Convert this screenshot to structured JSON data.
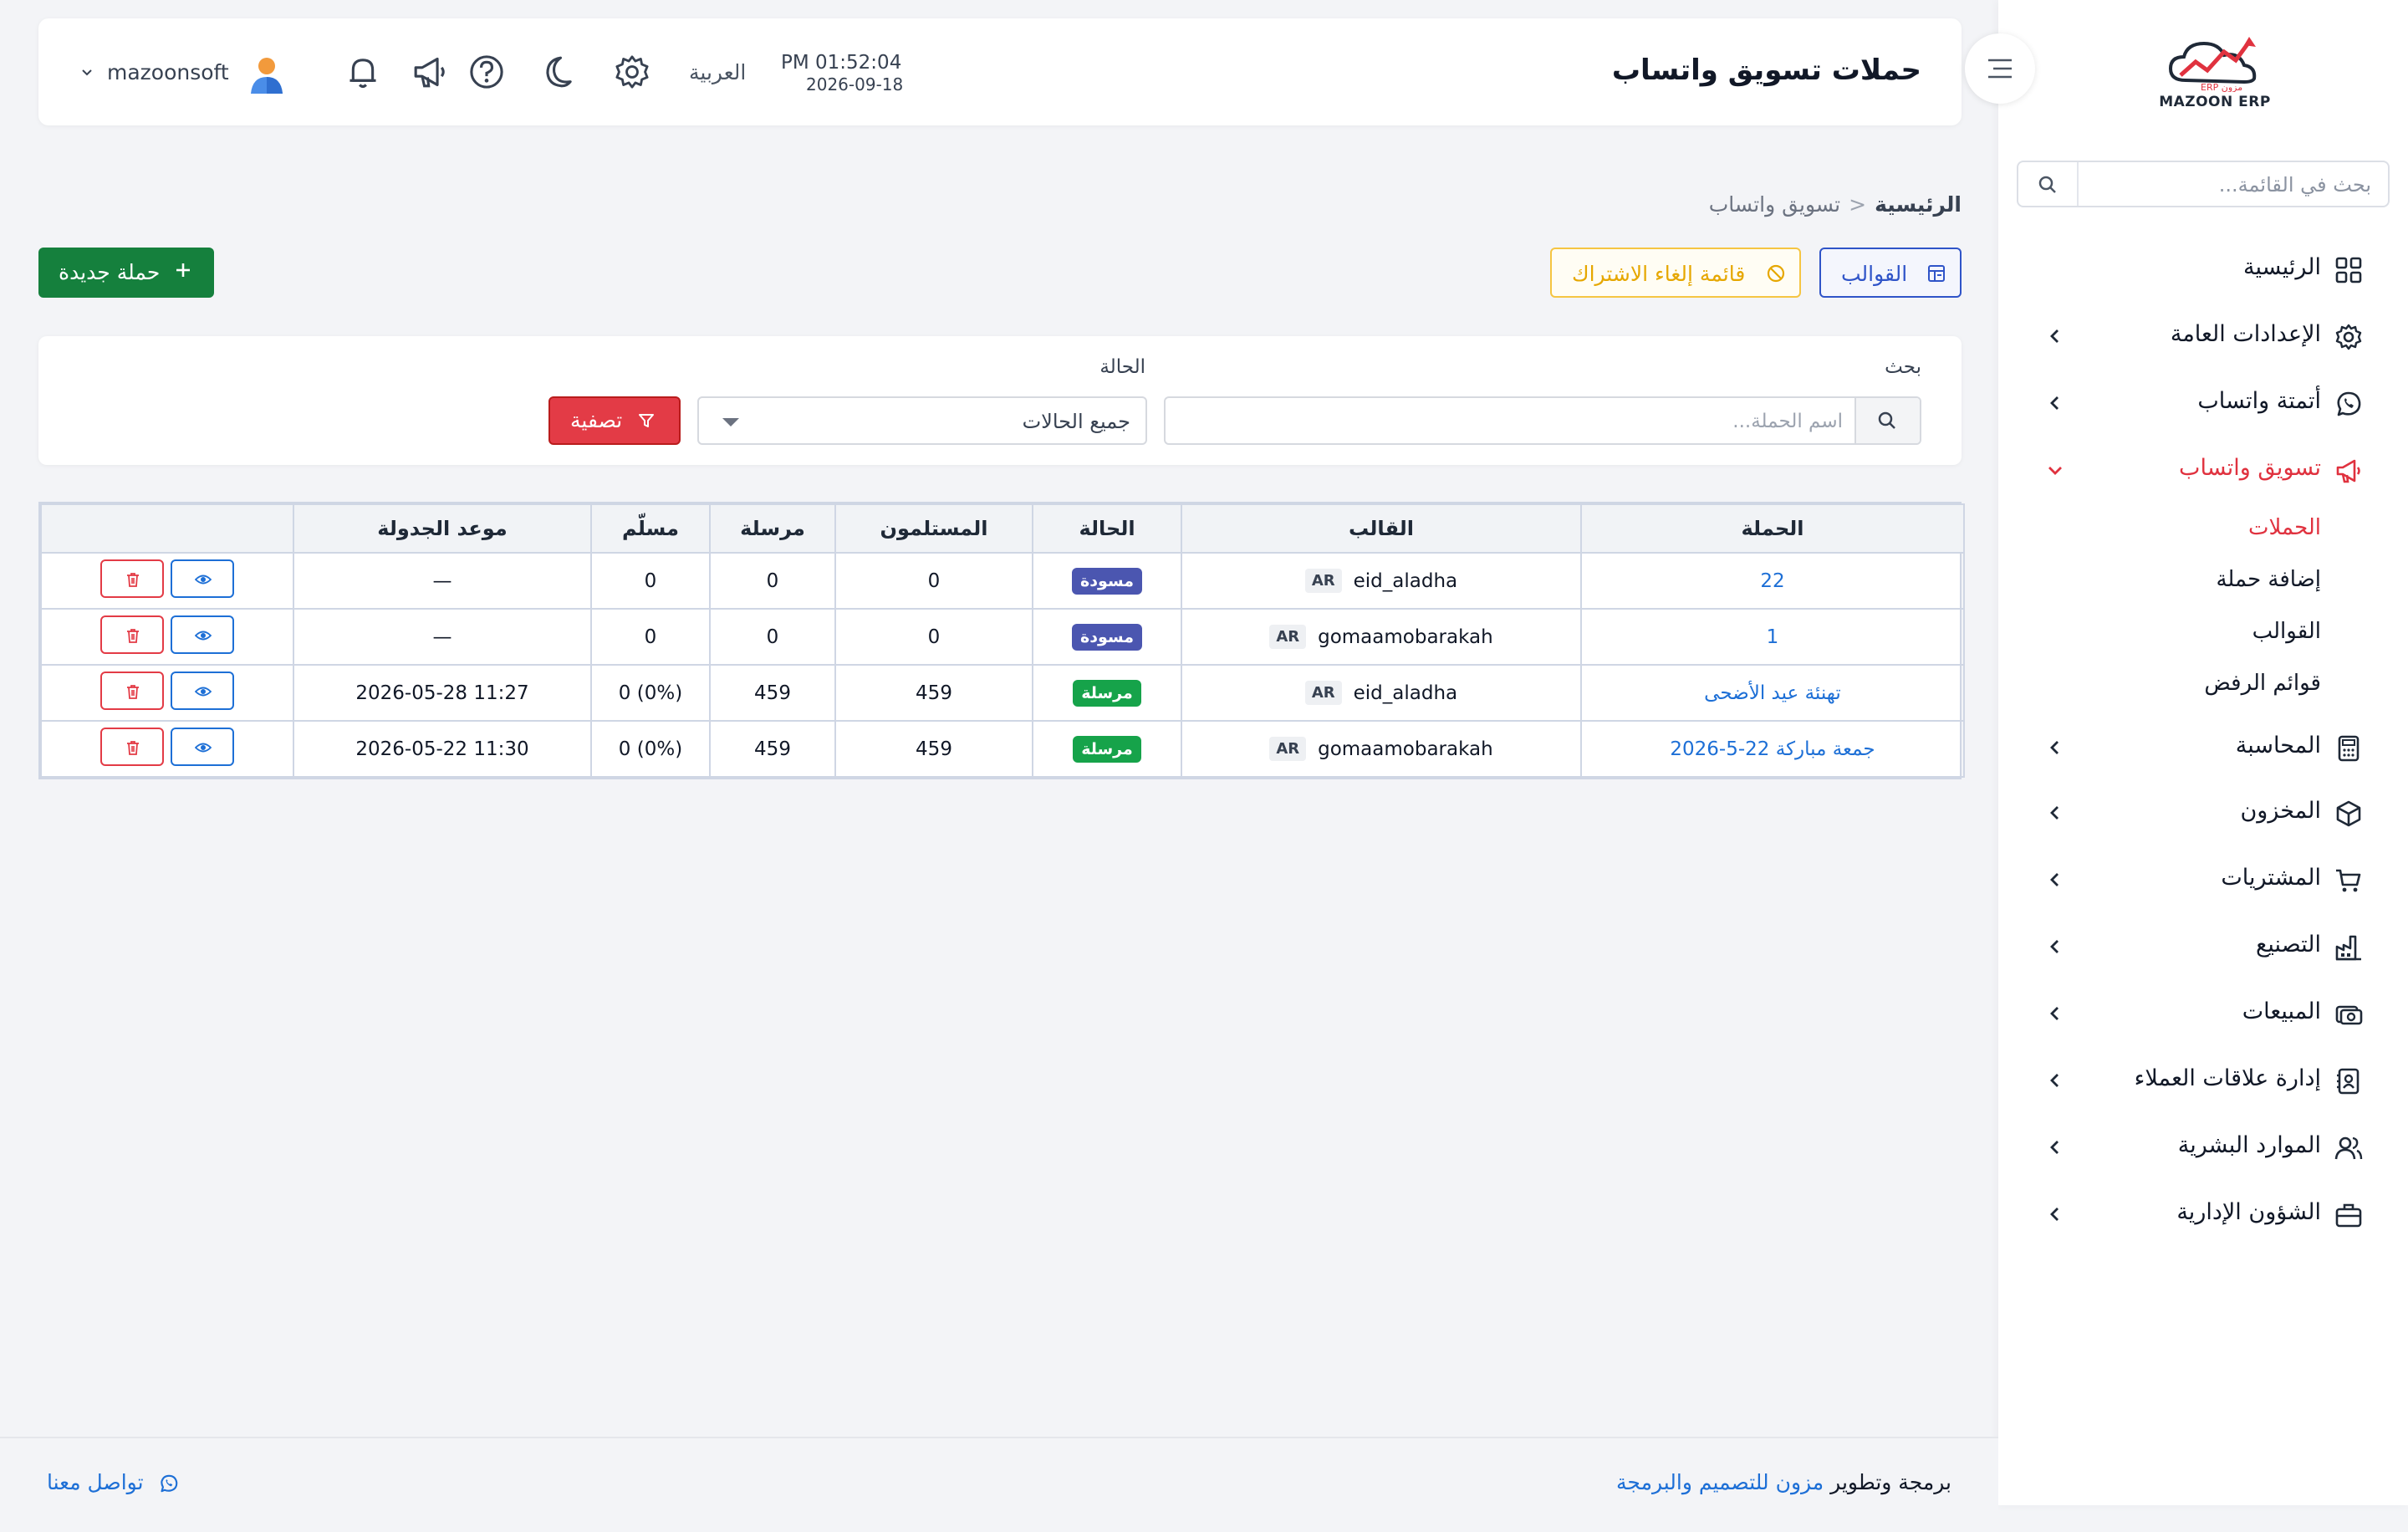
{
  "header": {
    "title": "حملات تسويق واتساب",
    "time": "PM 01:52:04",
    "date": "2026-09-18",
    "language": "العربية",
    "username": "mazoonsoft"
  },
  "sidebar": {
    "logo_text": "MAZOON ERP",
    "logo_subtext": "ERP مزون",
    "search_placeholder": "بحث في القائمة...",
    "items": [
      {
        "label": "الرئيسية",
        "icon": "grid-icon"
      },
      {
        "label": "الإعدادات العامة",
        "icon": "settings-icon"
      },
      {
        "label": "أتمتة واتساب",
        "icon": "whatsapp-icon"
      },
      {
        "label": "تسويق واتساب",
        "icon": "megaphone-icon"
      },
      {
        "label": "المحاسبة",
        "icon": "calculator-icon"
      },
      {
        "label": "المخزون",
        "icon": "box-icon"
      },
      {
        "label": "المشتريات",
        "icon": "cart-icon"
      },
      {
        "label": "التصنيع",
        "icon": "factory-icon"
      },
      {
        "label": "المبيعات",
        "icon": "sales-icon"
      },
      {
        "label": "إدارة علاقات العملاء",
        "icon": "contacts-icon"
      },
      {
        "label": "الموارد البشرية",
        "icon": "users-icon"
      },
      {
        "label": "الشؤون الإدارية",
        "icon": "briefcase-icon"
      }
    ],
    "subitems": [
      {
        "label": "الحملات"
      },
      {
        "label": "إضافة حملة"
      },
      {
        "label": "القوالب"
      },
      {
        "label": "قوائم الرفض"
      }
    ]
  },
  "breadcrumb": {
    "home": "الرئيسية",
    "separator": "<",
    "current": "تسويق واتساب"
  },
  "actions": {
    "templates": "القوالب",
    "unsubscribe_list": "قائمة إلغاء الاشتراك",
    "new_campaign": "حملة جديدة"
  },
  "filters": {
    "search_label": "بحث",
    "search_placeholder": "اسم الحملة...",
    "status_label": "الحالة",
    "status_value": "جميع الحالات",
    "filter_button": "تصفية"
  },
  "table": {
    "headers": [
      "الحملة",
      "القالب",
      "الحالة",
      "المستلمون",
      "مرسلة",
      "مسلّم",
      "موعد الجدولة",
      ""
    ],
    "rows": [
      {
        "campaign": "22",
        "template": "eid_aladha",
        "lang": "AR",
        "status": "مسودة",
        "recipients": "0",
        "sent": "0",
        "delivered": "0",
        "scheduled": "—"
      },
      {
        "campaign": "1",
        "template": "gomaamobarakah",
        "lang": "AR",
        "status": "مسودة",
        "recipients": "0",
        "sent": "0",
        "delivered": "0",
        "scheduled": "—"
      },
      {
        "campaign": "تهنئة عيد الأضحى",
        "template": "eid_aladha",
        "lang": "AR",
        "status": "مرسلة",
        "recipients": "459",
        "sent": "459",
        "delivered": "0 (0%)",
        "scheduled": "2026-05-28 11:27"
      },
      {
        "campaign": "جمعة مباركة 22-5-2026",
        "template": "gomaamobarakah",
        "lang": "AR",
        "status": "مرسلة",
        "recipients": "459",
        "sent": "459",
        "delivered": "0 (0%)",
        "scheduled": "2026-05-22 11:30"
      }
    ]
  },
  "footer": {
    "credit_prefix": "برمجة وتطوير",
    "credit_link": "مزون للتصميم والبرمجة",
    "contact": "تواصل معنا"
  },
  "colors": {
    "accent_red": "#e0323f",
    "primary_blue": "#2f54c8",
    "link_blue": "#1d6fd6",
    "new_button_green": "#15803d",
    "draft_badge": "#4b56b0",
    "sent_badge": "#16a34a",
    "unsubscribe_yellow": "#e6a700"
  }
}
